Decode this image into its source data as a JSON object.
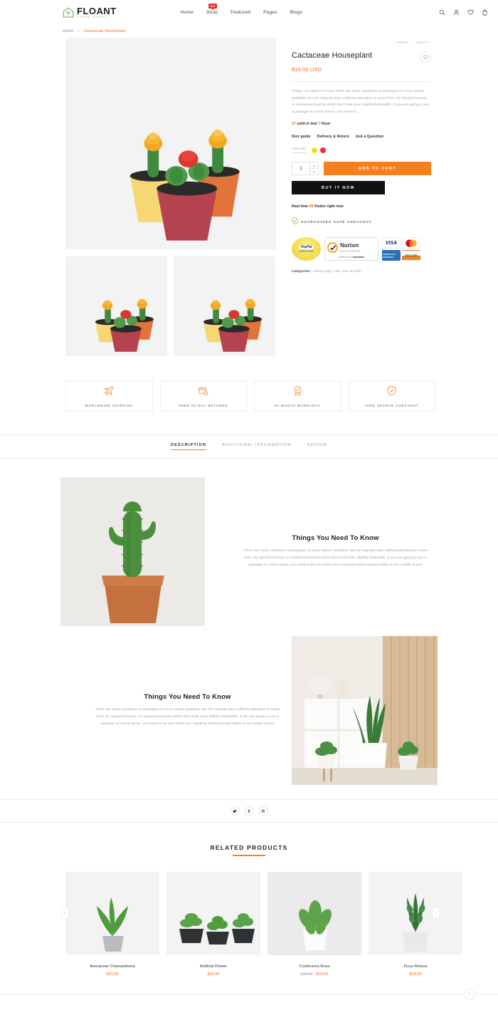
{
  "header": {
    "logo_name": "FLOANT",
    "logo_tagline": "Store Plant",
    "nav": [
      {
        "label": "Home",
        "badge": null
      },
      {
        "label": "Shop",
        "badge": "HOT"
      },
      {
        "label": "Featured",
        "badge": null
      },
      {
        "label": "Pages",
        "badge": null
      },
      {
        "label": "Blogs",
        "badge": null
      }
    ],
    "icons": [
      "search-icon",
      "account-icon",
      "wishlist-icon",
      "cart-icon"
    ]
  },
  "breadcrumb": {
    "home": "Home",
    "separator": ">",
    "current": "Cactaceae Houseplant"
  },
  "product": {
    "prev_label": "PREV",
    "next_label": "NEXT",
    "title": "Cactaceae Houseplant",
    "price": "$16.00 USD",
    "description": "Things You Need To Know There are many variations of passages of Lorem Ipsum available, but the majority have suffered alteration in some form, by injected humour, or randomised words which don't look even slightly believable. If you are going to use a passage of Lorem Ipsum, you need to...",
    "sold_count": "27",
    "sold_mid": "sold in last",
    "sold_hours": "7",
    "sold_unit": "Hour",
    "meta_links": [
      "Size guide",
      "Delivery & Return",
      "Ask a Question"
    ],
    "color_label": "COLOR",
    "colors": [
      {
        "name": "yellow",
        "hex": "#f5dc1e"
      },
      {
        "name": "red",
        "hex": "#e8322a"
      }
    ],
    "quantity": "1",
    "add_to_cart": "ADD TO CART",
    "buy_now": "BUY IT NOW",
    "realtime_prefix": "Real time",
    "visitor_count": "28",
    "realtime_suffix": "Visitor right now",
    "safe_checkout": "GUARANTEED SAFE CHECKOUT",
    "payments": {
      "paypal_line1": "PayPal",
      "paypal_line2": "VERIFIED",
      "norton_name": "Norton",
      "norton_sub": "SECURED",
      "norton_foot_prefix": "powered by",
      "norton_foot_brand": "Symantec",
      "cards": [
        "VISA",
        "MC",
        "AMERICAN EXPRESS",
        "DISCOVER"
      ]
    },
    "categories_label": "Categories :",
    "categories_value": "Home page, new, new arrivals",
    "accent_color": "#f26322"
  },
  "features": [
    {
      "label": "WORLDWIDE SHIPPING",
      "icon": "airplane-icon"
    },
    {
      "label": "FREE 60-DAY RETURNS",
      "icon": "return-box-icon"
    },
    {
      "label": "24 MONTH WARRANTY",
      "icon": "warranty-badge-icon"
    },
    {
      "label": "100% SECRUE CHECKOUT",
      "icon": "shield-check-icon"
    }
  ],
  "tabs": [
    {
      "label": "DESCRIPTION",
      "active": true
    },
    {
      "label": "ADDITIONAL INFORMATION",
      "active": false
    },
    {
      "label": "REVIEW",
      "active": false
    }
  ],
  "description_blocks": [
    {
      "heading": "Things You Need To Know",
      "body": "There are many variations of passages of Lorem Ipsum available, but the majority have suffered alteration in some form, by injected humour, or randomised words which don't look even slightly believable. If you are going to use a passage of Lorem Ipsum, you need to be sure there isn't anything embarrassing hidden in the middle of text"
    },
    {
      "heading": "Things You Need To Know",
      "body": "There are many variations of passages of Lorem Ipsum available, but the majority have suffered alteration in some form, by injected humour, or randomised words which don't look even slightly believable. If you are going to use a passage of Lorem Ipsum, you need to be sure there isn't anything embarrassing hidden in the middle of text"
    }
  ],
  "share": [
    {
      "name": "twitter-icon"
    },
    {
      "name": "facebook-icon"
    },
    {
      "name": "pinterest-icon"
    }
  ],
  "related": {
    "title": "RELATED PRODUCTS",
    "products": [
      {
        "name": "Arecaceae Chamaedorea",
        "price": "$20.00",
        "old_price": null
      },
      {
        "name": "Artificial Flower",
        "price": "$10.00",
        "old_price": null
      },
      {
        "name": "Cvetlicarna Rosa",
        "price": "$16.00",
        "old_price": "$18.00"
      },
      {
        "name": "Ficus Retusa",
        "price": "$19.00",
        "old_price": null
      }
    ],
    "prev_arrow": "‹",
    "next_arrow": "›"
  },
  "to_top": "↑"
}
